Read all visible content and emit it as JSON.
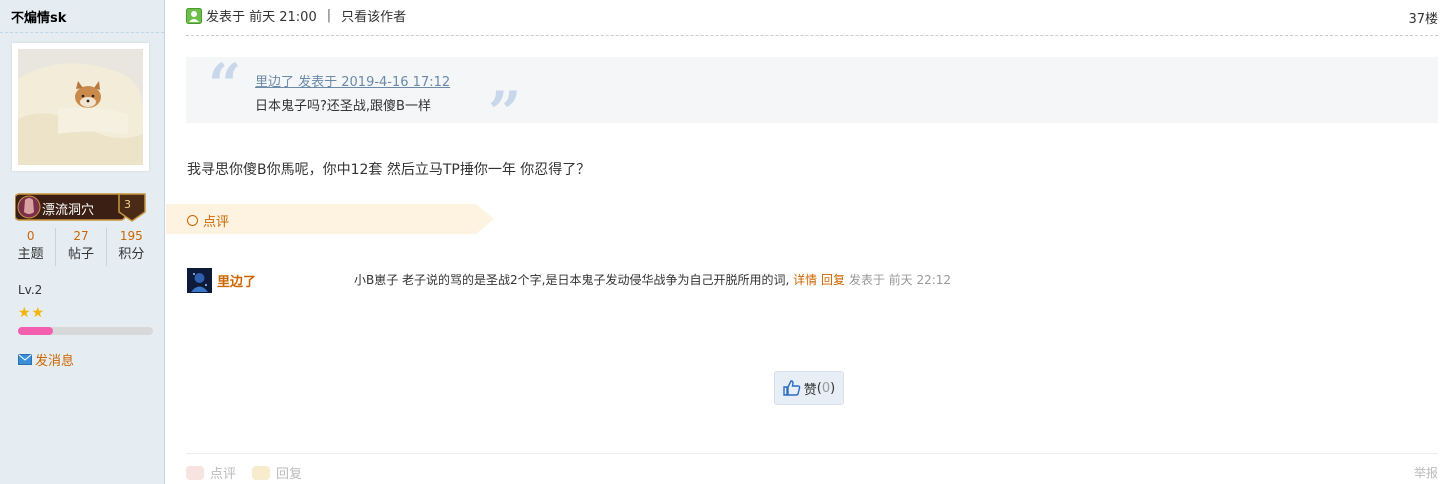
{
  "author": {
    "name": "不煸情sk",
    "medal_name": "漂流洞穴",
    "medal_level": "3",
    "stats": [
      {
        "value": "0",
        "label": "主题"
      },
      {
        "value": "27",
        "label": "帖子"
      },
      {
        "value": "195",
        "label": "积分"
      }
    ],
    "level": "Lv.2",
    "stars": "★★",
    "level_progress": 0.26,
    "send_message": "发消息"
  },
  "post": {
    "meta_posted": "发表于 前天 21:00",
    "meta_sep": "|",
    "meta_only_author": "只看该作者",
    "floor": "37楼",
    "quote": {
      "header": "里边了 发表于 2019-4-16 17:12",
      "body": "日本鬼子吗?还圣战,跟傻B一样"
    },
    "content": "我寻思你傻B你馬呢，你中12套 然后立马TP捶你一年 你忍得了？"
  },
  "comments_section": {
    "title": "点评",
    "items": [
      {
        "name": "里边了",
        "text": "小B崽子 老子说的骂的是圣战2个字,是日本鬼子发动侵华战争为自己开脱所用的词,",
        "detail": "详情",
        "reply": "回复",
        "time": "发表于 前天 22:12"
      }
    ]
  },
  "like": {
    "label": "赞",
    "count_open": "(",
    "count": "0",
    "count_close": ")"
  },
  "footer": {
    "comment": "点评",
    "reply": "回复",
    "report": "举报"
  },
  "colors": {
    "accent": "#cc6600",
    "sidebar_bg": "#e5edf2",
    "quote_bg": "#f4f6f8"
  }
}
